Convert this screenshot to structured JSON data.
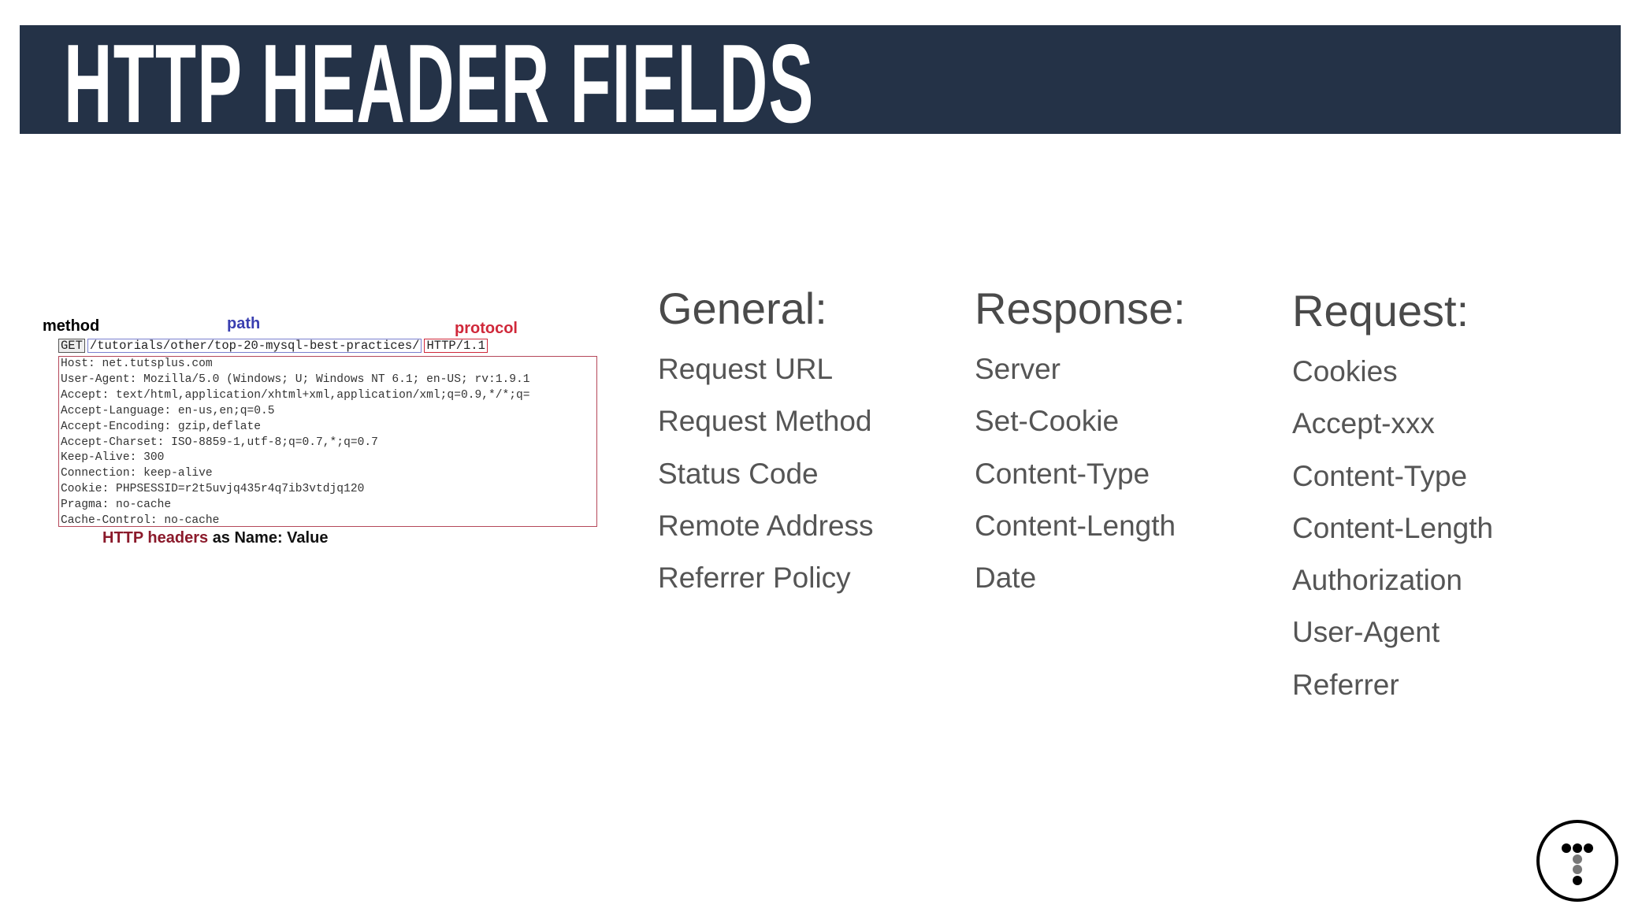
{
  "title": "HTTP HEADER FIELDS",
  "diagram": {
    "method_label": "method",
    "path_label": "path",
    "protocol_label": "protocol",
    "request_line": {
      "method": "GET",
      "path": "/tutorials/other/top-20-mysql-best-practices/",
      "protocol": "HTTP/1.1"
    },
    "header_lines": [
      "Host: net.tutsplus.com",
      "User-Agent: Mozilla/5.0 (Windows; U; Windows NT 6.1; en-US; rv:1.9.1",
      "Accept: text/html,application/xhtml+xml,application/xml;q=0.9,*/*;q=",
      "Accept-Language: en-us,en;q=0.5",
      "Accept-Encoding: gzip,deflate",
      "Accept-Charset: ISO-8859-1,utf-8;q=0.7,*;q=0.7",
      "Keep-Alive: 300",
      "Connection: keep-alive",
      "Cookie: PHPSESSID=r2t5uvjq435r4q7ib3vtdjq120",
      "Pragma: no-cache",
      "Cache-Control: no-cache"
    ],
    "caption_highlight": "HTTP headers",
    "caption_rest": "as Name: Value",
    "colors": {
      "method": "#000000",
      "path": "#3a3fb0",
      "protocol": "#d0283a",
      "caption": "#8b1a2b"
    }
  },
  "columns": [
    {
      "heading": "General:",
      "items": [
        "Request URL",
        "Request Method",
        "Status Code",
        "Remote Address",
        "Referrer Policy"
      ]
    },
    {
      "heading": "Response:",
      "items": [
        "Server",
        "Set-Cookie",
        "Content-Type",
        "Content-Length",
        "Date"
      ]
    },
    {
      "heading": "Request:",
      "items": [
        "Cookies",
        "Accept-xxx",
        "Content-Type",
        "Content-Length",
        "Authorization",
        "User-Agent",
        "Referrer"
      ]
    }
  ],
  "logo": {
    "icon": "tutsplus-logo-icon"
  },
  "colors": {
    "title_bar": "#243247",
    "title_text": "#ffffff"
  }
}
